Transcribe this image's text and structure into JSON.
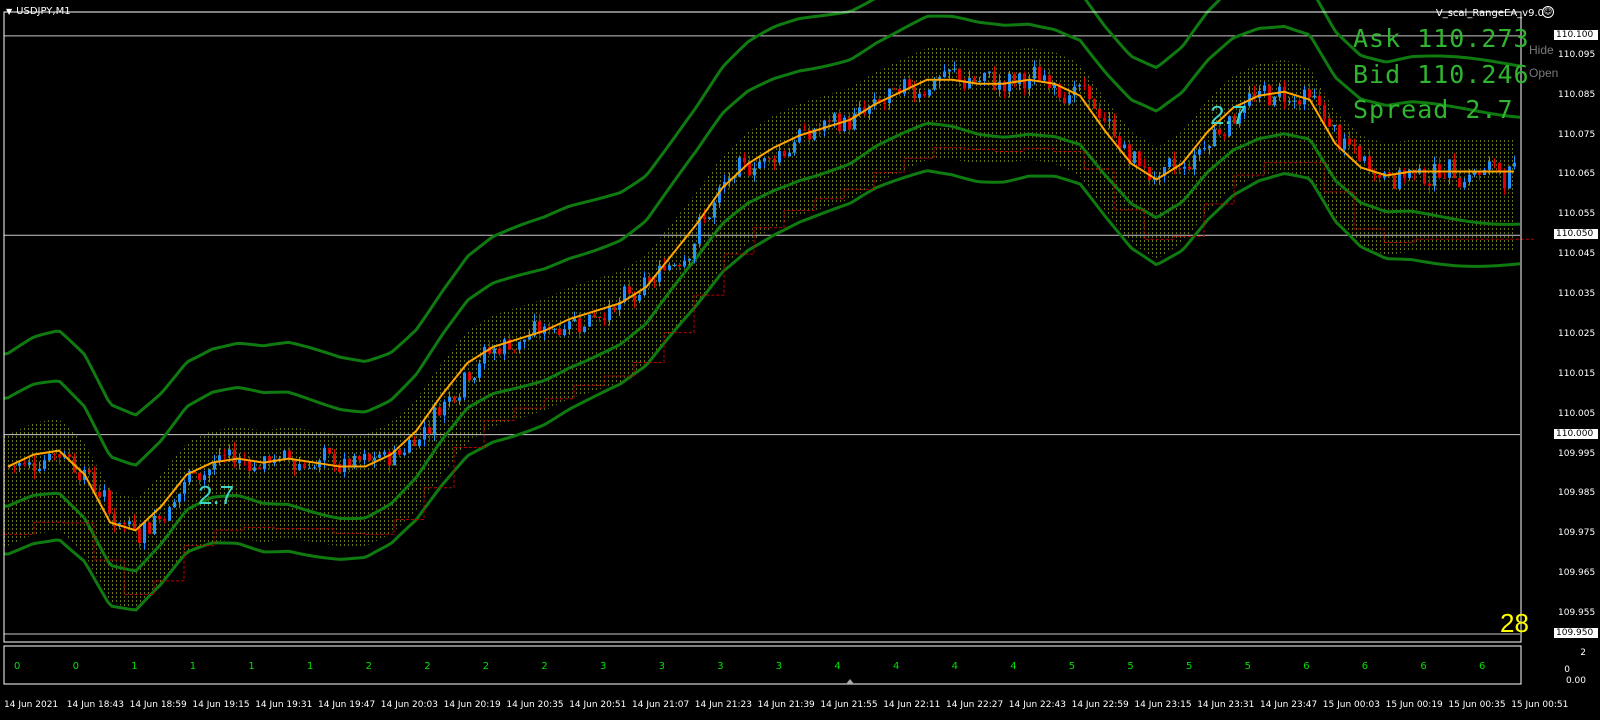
{
  "window": {
    "symbol_title": "USDJPY,M1",
    "ea_name": "V_scal_RangeEA_v9.0",
    "smiley": "☺"
  },
  "info": {
    "ask": "Ask 110.273",
    "bid": "Bid 110.246",
    "spread": "Spread 2.7",
    "hide_label": "Hide",
    "open_label": "Open"
  },
  "chart_labels": {
    "spread_left": "2.7",
    "spread_right": "2.7",
    "tick_count": "28"
  },
  "price_axis": [
    "110.100",
    "110.095",
    "110.085",
    "110.075",
    "110.065",
    "110.055",
    "110.050",
    "110.045",
    "110.035",
    "110.025",
    "110.015",
    "110.005",
    "110.000",
    "109.995",
    "109.985",
    "109.975",
    "109.965",
    "109.955",
    "109.950"
  ],
  "highlighted_prices": [
    "110.100",
    "110.050",
    "110.000",
    "109.950"
  ],
  "time_axis": [
    "14 Jun 2021",
    "14 Jun 18:43",
    "14 Jun 18:59",
    "14 Jun 19:15",
    "14 Jun 19:31",
    "14 Jun 19:47",
    "14 Jun 20:03",
    "14 Jun 20:19",
    "14 Jun 20:35",
    "14 Jun 20:51",
    "14 Jun 21:07",
    "14 Jun 21:23",
    "14 Jun 21:39",
    "14 Jun 21:55",
    "14 Jun 22:11",
    "14 Jun 22:27",
    "14 Jun 22:43",
    "14 Jun 22:59",
    "14 Jun 23:15",
    "14 Jun 23:31",
    "14 Jun 23:47",
    "15 Jun 00:03",
    "15 Jun 00:19",
    "15 Jun 00:35",
    "15 Jun 00:51"
  ],
  "subwindow": {
    "labels": [
      "0",
      "0",
      "1",
      "1",
      "1",
      "1",
      "2",
      "2",
      "2",
      "2",
      "3",
      "3",
      "3",
      "3",
      "4",
      "4",
      "4",
      "4",
      "5",
      "5",
      "5",
      "5",
      "6",
      "6",
      "6",
      "6"
    ],
    "axis_top": "2",
    "axis_bottom": "0.00",
    "axis_zero": "0"
  },
  "colors": {
    "background": "#000000",
    "bull_candle": "#1e90ff",
    "bear_candle": "#e00000",
    "moving_average": "#ffa500",
    "bands": "#0f7a0f",
    "range_fill": "#6b7a14",
    "range_line_red": "#c00000",
    "info_text": "#2fb52f",
    "spread_label": "#3fd3c8",
    "tick_count": "#ffff00"
  },
  "chart_data": {
    "type": "line",
    "title": "USDJPY,M1",
    "xlabel": "",
    "ylabel": "",
    "ylim": [
      109.948,
      110.106
    ],
    "x_range": [
      "14 Jun 2021",
      "15 Jun 00:51"
    ],
    "grid": false,
    "series": [
      {
        "values": [
          109.992,
          109.995,
          109.996,
          109.99,
          109.978,
          109.976,
          109.982,
          109.99,
          109.993,
          109.994,
          109.993,
          109.994,
          109.993,
          109.992,
          109.992,
          109.995,
          110.001,
          110.01,
          110.018,
          110.022,
          110.024,
          110.026,
          110.029,
          110.031,
          110.033,
          110.037,
          110.045,
          110.053,
          110.062,
          110.068,
          110.072,
          110.075,
          110.077,
          110.079,
          110.083,
          110.086,
          110.089,
          110.089,
          110.088,
          110.088,
          110.089,
          110.088,
          110.085,
          110.076,
          110.068,
          110.064,
          110.068,
          110.076,
          110.082,
          110.085,
          110.086,
          110.084,
          110.073,
          110.067,
          110.065,
          110.066,
          110.066,
          110.066,
          110.066,
          110.066
        ]
      }
    ]
  }
}
